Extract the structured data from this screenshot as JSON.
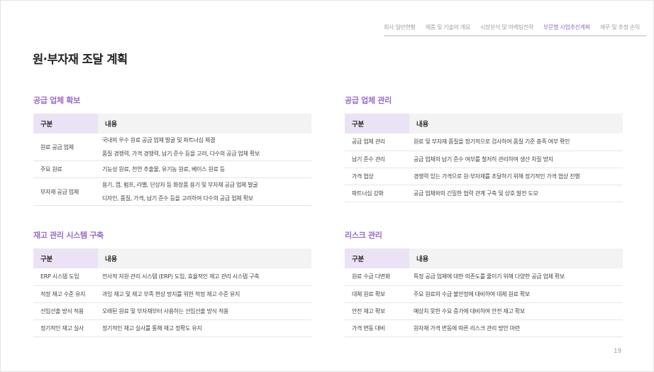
{
  "nav": [
    {
      "label": "회사 일반현황",
      "active": false
    },
    {
      "label": "제품 및 기술의 개요",
      "active": false
    },
    {
      "label": "시장분석 및 마케팅전략",
      "active": false
    },
    {
      "label": "부문별 사업추진계획",
      "active": true
    },
    {
      "label": "재무 및 추정 손익",
      "active": false
    }
  ],
  "page_title": "원·부자재 조달 계획",
  "header": {
    "col_a": "구분",
    "col_b": "내용"
  },
  "sections": [
    {
      "title": "공급 업체 확보",
      "rows": [
        {
          "label": "원료 공급 업체",
          "lines": [
            "국내외 우수 원료 공급 업체 발굴 및 파트너십 체결",
            "품질 경쟁력, 가격 경쟁력, 납기 준수 등을 고려, 다수의 공급 업체 확보"
          ]
        },
        {
          "label": "주요 원료",
          "lines": [
            "기능성 원료, 천연 추출물, 유기농 원료, 베이스 원료 등"
          ]
        },
        {
          "label": "부자재 공급 업체",
          "lines": [
            "용기, 캡, 펌프, 라벨, 단상자 등 화장품 용기 및 부자재 공급 업체 발굴",
            "디자인, 품질, 가격, 납기 준수 등을 고려하여 다수의 공급 업체 확보"
          ]
        }
      ]
    },
    {
      "title": "공급 업체 관리",
      "rows": [
        {
          "label": "공급 업체 관리",
          "lines": [
            "원료 및 부자재 품질을 정기적으로 검사하여 품질 기준 충족 여부 확인"
          ]
        },
        {
          "label": "납기 준수 관리",
          "lines": [
            "공급 업체의 납기 준수 여부를 철저히 관리하여 생산 차질 방지"
          ]
        },
        {
          "label": "가격 협상",
          "lines": [
            "경쟁력 있는 가격으로 원·부자재를 조달하기 위해 정기적인 가격 협상 진행"
          ]
        },
        {
          "label": "파트너십 강화",
          "lines": [
            "공급 업체와의 긴밀한 협력 관계 구축 및 상호 발전 도모"
          ]
        }
      ]
    },
    {
      "title": "재고 관리 시스템 구축",
      "rows": [
        {
          "label": "ERP 시스템 도입",
          "lines": [
            "전사적 자원 관리 시스템 (ERP) 도입, 효율적인 재고 관리 시스템 구축"
          ]
        },
        {
          "label": "적정 재고 수준 유지",
          "lines": [
            "과잉 재고 및 재고 부족 현상 방지를 위한 적정 재고 수준 유지"
          ]
        },
        {
          "label": "선입선출 방식 적용",
          "lines": [
            "오래된 원료 및 부자재부터 사용하는 선입선출 방식 적용"
          ]
        },
        {
          "label": "정기적인 재고 실사",
          "lines": [
            "정기적인 재고 실사를 통해 재고 정확도 유지"
          ]
        }
      ]
    },
    {
      "title": "리스크 관리",
      "rows": [
        {
          "label": "원료 수급 다변화",
          "lines": [
            "특정 공급 업체에 대한 의존도를 줄이기 위해 다양한 공급 업체 확보"
          ]
        },
        {
          "label": "대체 원료 확보",
          "lines": [
            "주요 원료의 수급 불안정에 대비하여 대체 원료 확보"
          ]
        },
        {
          "label": "안전 재고 확보",
          "lines": [
            "예상치 못한 수요 증가에 대비하여 안전 재고 확보"
          ]
        },
        {
          "label": "가격 변동 대비",
          "lines": [
            "원자재 가격 변동에 따른 리스크 관리 방안 마련"
          ]
        }
      ]
    }
  ],
  "page_number": "19"
}
